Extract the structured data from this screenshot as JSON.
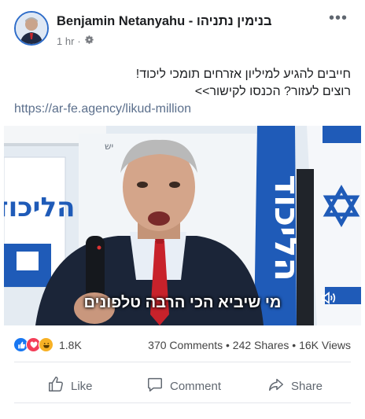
{
  "post": {
    "author": "Benjamin Netanyahu - בנימין נתניהו",
    "time": "1 hr",
    "privacy_icon": "gear-icon",
    "more_icon": "ellipsis-icon",
    "text_lines": [
      "חייבים להגיע למיליון אזרחים תומכי ליכוד!",
      "רוצים לעזור? הכנסו לקישור>>"
    ],
    "link": "https://ar-fe.agency/likud-million"
  },
  "video": {
    "caption": "מי שיביא הכי הרבה טלפונים",
    "volume_icon": "speaker-icon",
    "poster_sign": "הליכוד",
    "flag_text": "הליכוד",
    "wall_text": "יש"
  },
  "stats": {
    "reactions": [
      "like",
      "love",
      "haha"
    ],
    "reaction_count": "1.8K",
    "comments": "370 Comments",
    "shares": "242 Shares",
    "views": "16K Views",
    "separator": "•"
  },
  "actions": {
    "like": "Like",
    "comment": "Comment",
    "share": "Share"
  },
  "colors": {
    "like_blue": "#1877f2",
    "love_red": "#f33e58",
    "haha_yellow": "#f7b125",
    "flag_blue": "#1f5bb8"
  }
}
